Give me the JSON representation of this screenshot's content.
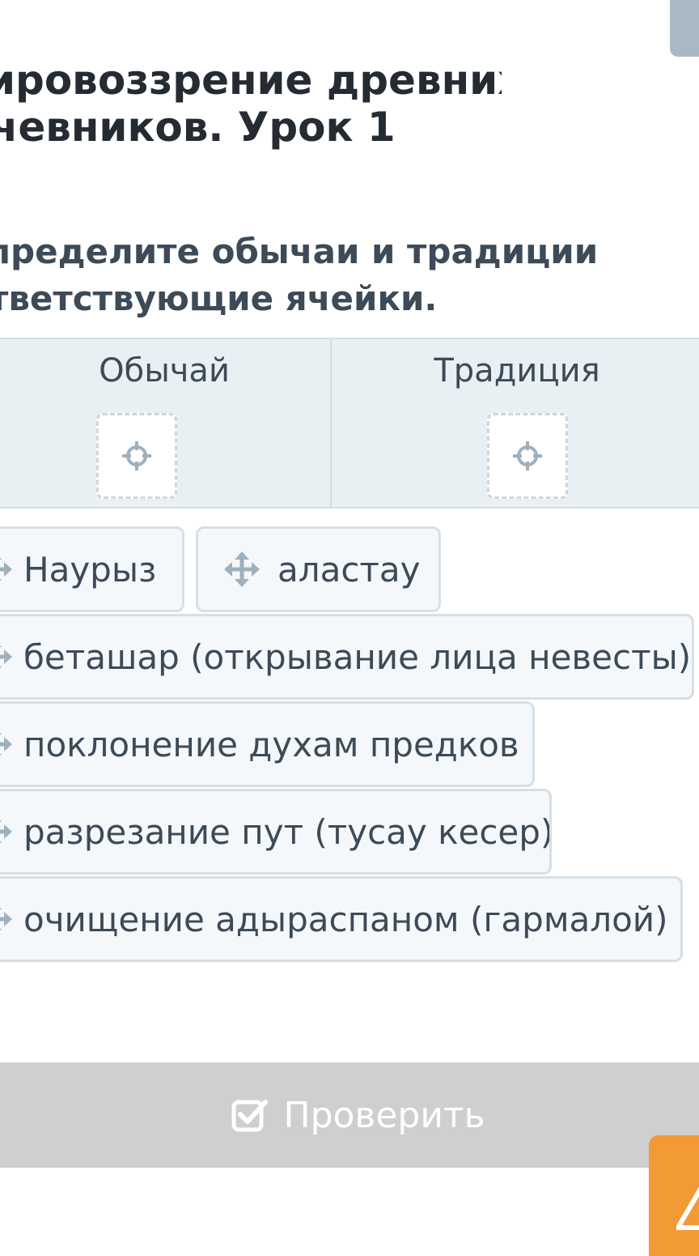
{
  "lesson": {
    "title_line1": "ировоззрение древних",
    "title_line2": "чевников. Урок 1"
  },
  "task": {
    "line1": "пределите обычаи и традиции в",
    "line2": "тветствующие ячейки."
  },
  "table": {
    "columns": [
      {
        "header": "Обычай"
      },
      {
        "header": "Традиция"
      }
    ]
  },
  "chips": [
    {
      "label": "Наурыз"
    },
    {
      "label": "аластау"
    },
    {
      "label": "беташар (открывание лица невесты)"
    },
    {
      "label": "поклонение духам предков"
    },
    {
      "label": "разрезание пут (тусау кесер)"
    },
    {
      "label": "очищение адыраспаном (гармалой)"
    }
  ],
  "actions": {
    "check_label": "Проверить"
  },
  "colors": {
    "accent_orange": "#f29a35",
    "check_bar": "#cfcfcf",
    "table_bg": "#e9f0f4",
    "chip_bg": "#f4f8fb"
  },
  "icons": {
    "drop_target": "crosshair-target-icon",
    "chip_handle": "move-arrows-icon",
    "check": "checkbox-check-icon",
    "help": "warning-triangle-icon"
  }
}
